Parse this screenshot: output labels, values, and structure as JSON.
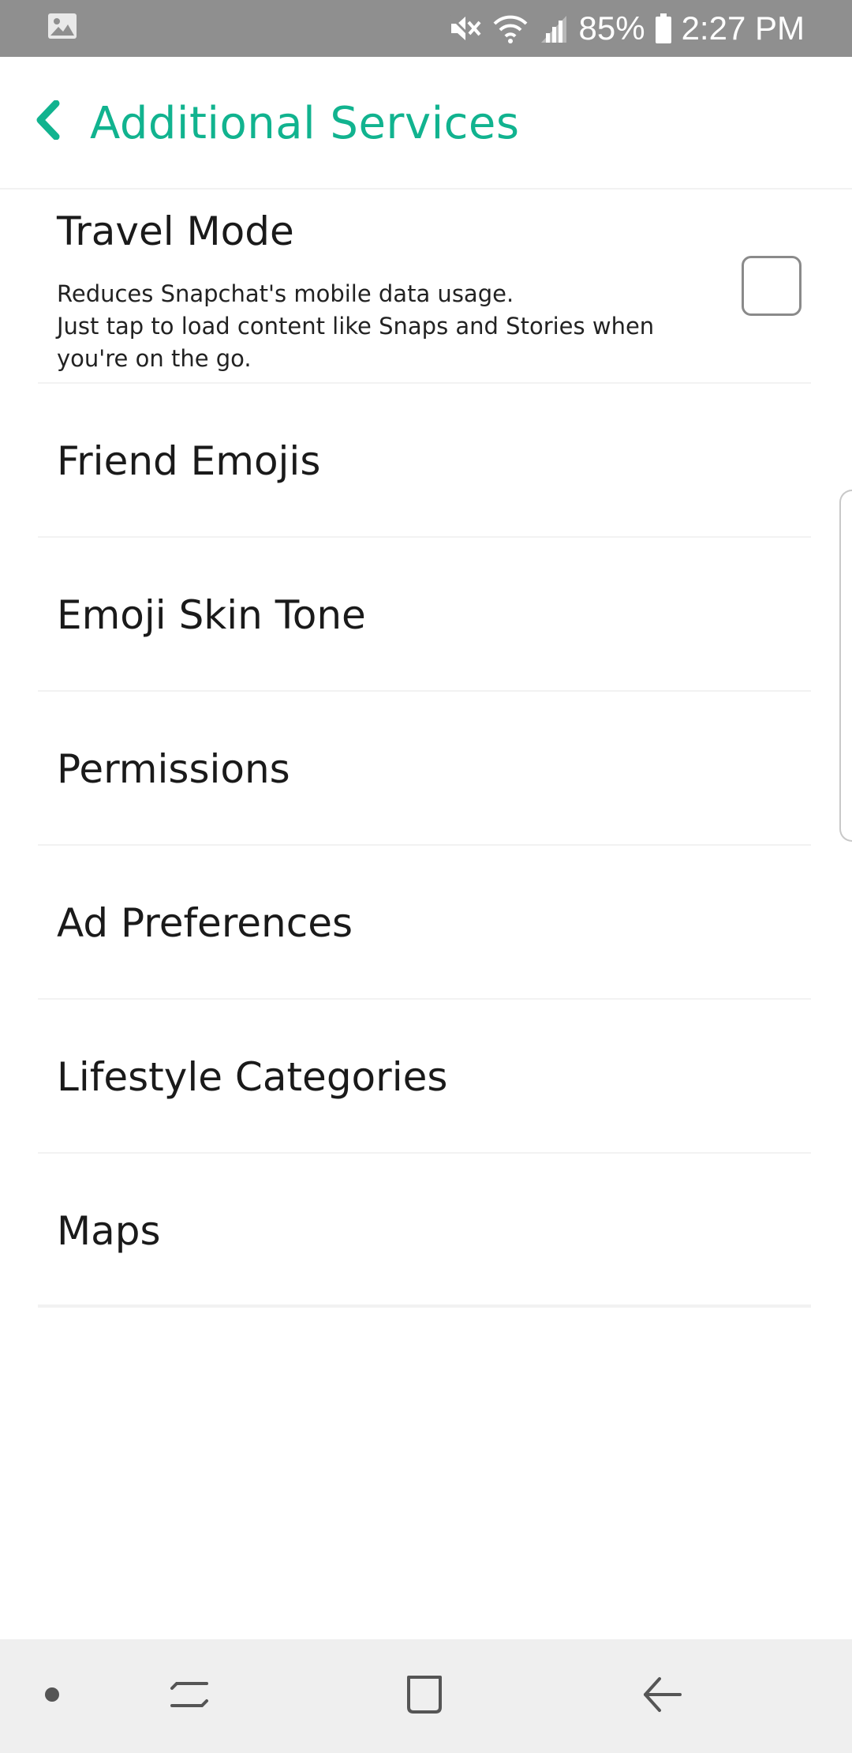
{
  "status_bar": {
    "battery": "85%",
    "time": "2:27 PM",
    "icons": [
      "gallery-icon",
      "mute-icon",
      "wifi-icon",
      "signal-icon",
      "battery-icon"
    ]
  },
  "header": {
    "back_icon": "chevron-left-icon",
    "title": "Additional Services"
  },
  "travel_mode": {
    "title": "Travel Mode",
    "description_line1": "Reduces Snapchat's mobile data usage.",
    "description_line2": "Just tap to load content like Snaps and Stories when you're on the go.",
    "checked": false
  },
  "items": [
    {
      "label": "Friend Emojis"
    },
    {
      "label": "Emoji Skin Tone"
    },
    {
      "label": "Permissions"
    },
    {
      "label": "Ad Preferences"
    },
    {
      "label": "Lifestyle Categories"
    },
    {
      "label": "Maps"
    }
  ],
  "nav_bar": {
    "icons": [
      "dot-icon",
      "recent-apps-icon",
      "home-icon",
      "back-arrow-icon"
    ]
  },
  "colors": {
    "accent": "#11b38f",
    "status_bar": "#8f8f8f",
    "nav_bar": "#efefef",
    "divider": "#f2f2f2"
  }
}
